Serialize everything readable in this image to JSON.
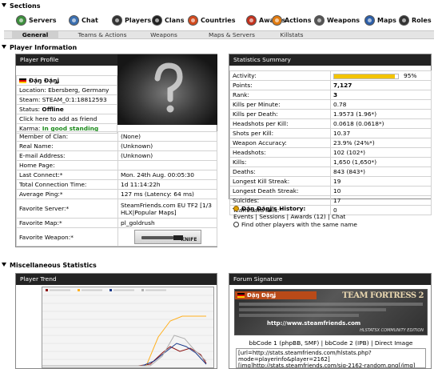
{
  "sections_title": "Sections",
  "nav": [
    {
      "label": "Servers",
      "icon": "servers-icon",
      "color": "#3d8f3d"
    },
    {
      "label": "Chat",
      "icon": "chat-icon",
      "color": "#3b6fb0"
    },
    {
      "label": "Players",
      "icon": "players-icon",
      "color": "#333333"
    },
    {
      "label": "Clans",
      "icon": "clans-icon",
      "color": "#222222"
    },
    {
      "label": "Countries",
      "icon": "countries-icon",
      "color": "#d14a1e"
    },
    {
      "label": "Awards",
      "icon": "awards-icon",
      "color": "#c3321e"
    },
    {
      "label": "Actions",
      "icon": "actions-icon",
      "color": "#e07a10"
    },
    {
      "label": "Weapons",
      "icon": "weapons-icon",
      "color": "#555555"
    },
    {
      "label": "Maps",
      "icon": "maps-icon",
      "color": "#2d5fa8"
    },
    {
      "label": "Roles",
      "icon": "roles-icon",
      "color": "#333333"
    }
  ],
  "subtabs": [
    "General",
    "Teams & Actions",
    "Weapons",
    "Maps & Servers",
    "Killstats"
  ],
  "player_info_title": "Player Information",
  "profile": {
    "header": "Player Profile",
    "name": "Đặŋ Đặŋʝ",
    "location": "Location: Ebersberg, Germany",
    "steam": "Steam: STEAM_0:1:18812593",
    "status_label": "Status:",
    "status_value": "Offline",
    "add_friend": "Click here to add as friend",
    "karma_label": "Karma:",
    "karma_value": "In good standing",
    "rows": [
      {
        "label": "Member of Clan:",
        "value": "(None)"
      },
      {
        "label": "Real Name:",
        "value": "(Unknown)"
      },
      {
        "label": "E-mail Address:",
        "value": "(Unknown)"
      },
      {
        "label": "Home Page:",
        "value": ""
      },
      {
        "label": "Last Connect:*",
        "value": "Mon. 24th Aug. 00:05:30"
      },
      {
        "label": "Total Connection Time:",
        "value": "1d 11:14:22h"
      },
      {
        "label": "Average Ping:*",
        "value": "127 ms (Latency: 64 ms)"
      }
    ],
    "fav_server_label": "Favorite Server:*",
    "fav_server_line1": "SteamFriends.com EU TF2 [1/3",
    "fav_server_line2": "HLX|Popular Maps]",
    "fav_map_label": "Favorite Map:*",
    "fav_map_value": "pl_goldrush",
    "fav_weapon_label": "Favorite Weapon:*",
    "fav_weapon_caption": "KNIFE"
  },
  "stats": {
    "header": "Statistics Summary",
    "activity_label": "Activity:",
    "activity_value": "95%",
    "activity_fraction": 0.95,
    "rows": [
      {
        "label": "Points:",
        "value": "7,127",
        "bold": true
      },
      {
        "label": "Rank:",
        "value": "3",
        "bold": true
      },
      {
        "label": "Kills per Minute:",
        "value": "0.78"
      },
      {
        "label": "Kills per Death:",
        "value": "1.9573 (1.96*)"
      },
      {
        "label": "Headshots per Kill:",
        "value": "0.0618 (0.0618*)"
      },
      {
        "label": "Shots per Kill:",
        "value": "10.37"
      },
      {
        "label": "Weapon Accuracy:",
        "value": "23.9% (24%*)"
      },
      {
        "label": "Headshots:",
        "value": "102 (102*)"
      },
      {
        "label": "Kills:",
        "value": "1,650 (1,650*)"
      },
      {
        "label": "Deaths:",
        "value": "843 (843*)"
      },
      {
        "label": "Longest Kill Streak:",
        "value": "19"
      },
      {
        "label": "Longest Death Streak:",
        "value": "10"
      },
      {
        "label": "Suicides:",
        "value": "17"
      },
      {
        "label": "Teammate Kills:*",
        "value": "0"
      }
    ],
    "history_title": "Đặŋ Đặŋʝ's History:",
    "history_links": [
      "Events",
      "Sessions",
      "Awards (12)",
      "Chat"
    ],
    "find_others": "Find other players with the same name"
  },
  "misc_title": "Miscellaneous Statistics",
  "trend": {
    "header": "Player Trend",
    "series_colors": [
      "#8b1010",
      "#ffb020",
      "#1a3a8a",
      "#b0b0b0"
    ]
  },
  "signature": {
    "header": "Forum Signature",
    "banner_name": "Đặŋ Đặŋʝ",
    "banner_logo": "TEAM FORTRESS 2",
    "banner_url": "http://www.steamfriends.com",
    "banner_footer": "HLSTATSX COMMUNITY EDITION",
    "bbcode_links": [
      "bbCode 1 (phpBB, SMF)",
      "bbCode 2 (IPB)",
      "Direct Image"
    ],
    "bbcode_text": "[url=http://stats.steamfriends.com/hlstats.php?mode=playerinfo&player=2162][img]http://stats.steamfriends.com/sig-2162-random.png[/img][/url]"
  }
}
